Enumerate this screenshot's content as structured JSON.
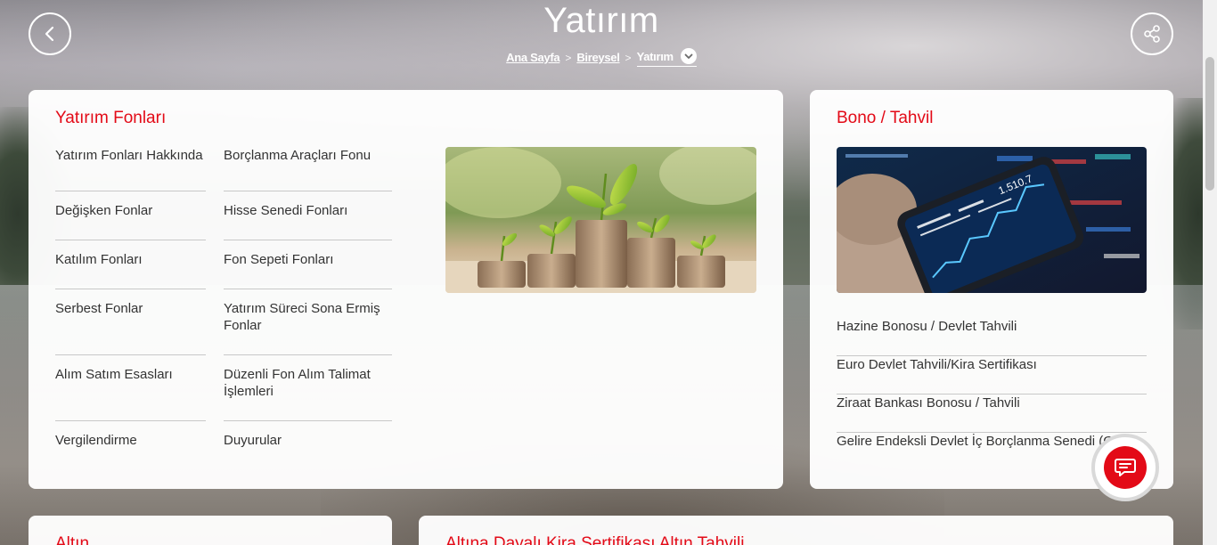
{
  "header": {
    "title": "Yatırım",
    "breadcrumb": {
      "home": "Ana Sayfa",
      "section": "Bireysel",
      "current": "Yatırım"
    }
  },
  "funds": {
    "title": "Yatırım Fonları",
    "col1": [
      "Yatırım Fonları Hakkında",
      "Değişken Fonlar",
      "Katılım Fonları",
      "Serbest Fonlar",
      "Alım Satım Esasları",
      "Vergilendirme"
    ],
    "col2": [
      "Borçlanma Araçları Fonu",
      "Hisse Senedi Fonları",
      "Fon Sepeti Fonları",
      "Yatırım Süreci Sona Ermiş Fonlar",
      "Düzenli Fon Alım Talimat İşlemleri",
      "Duyurular"
    ]
  },
  "bonds": {
    "title": "Bono / Tahvil",
    "links": [
      "Hazine Bonosu / Devlet Tahvili",
      "Euro Devlet Tahvili/Kira Sertifikası",
      "Ziraat Bankası Bonosu / Tahvili",
      "Gelire Endeksli Devlet İç Borçlanma Senedi (GES)"
    ],
    "phone_readout": "1.510.7"
  },
  "gold": {
    "title": "Altın"
  },
  "sukuk": {
    "title": "Altına Dayalı Kira Sertifikası Altın Tahvili"
  },
  "colors": {
    "accent": "#e30a17",
    "text": "#333333",
    "divider": "#c8c8c8"
  },
  "icons": {
    "back": "chevron-left-icon",
    "share": "share-icon",
    "dropdown": "chevron-down-icon",
    "chat": "chat-bubble-icon"
  }
}
